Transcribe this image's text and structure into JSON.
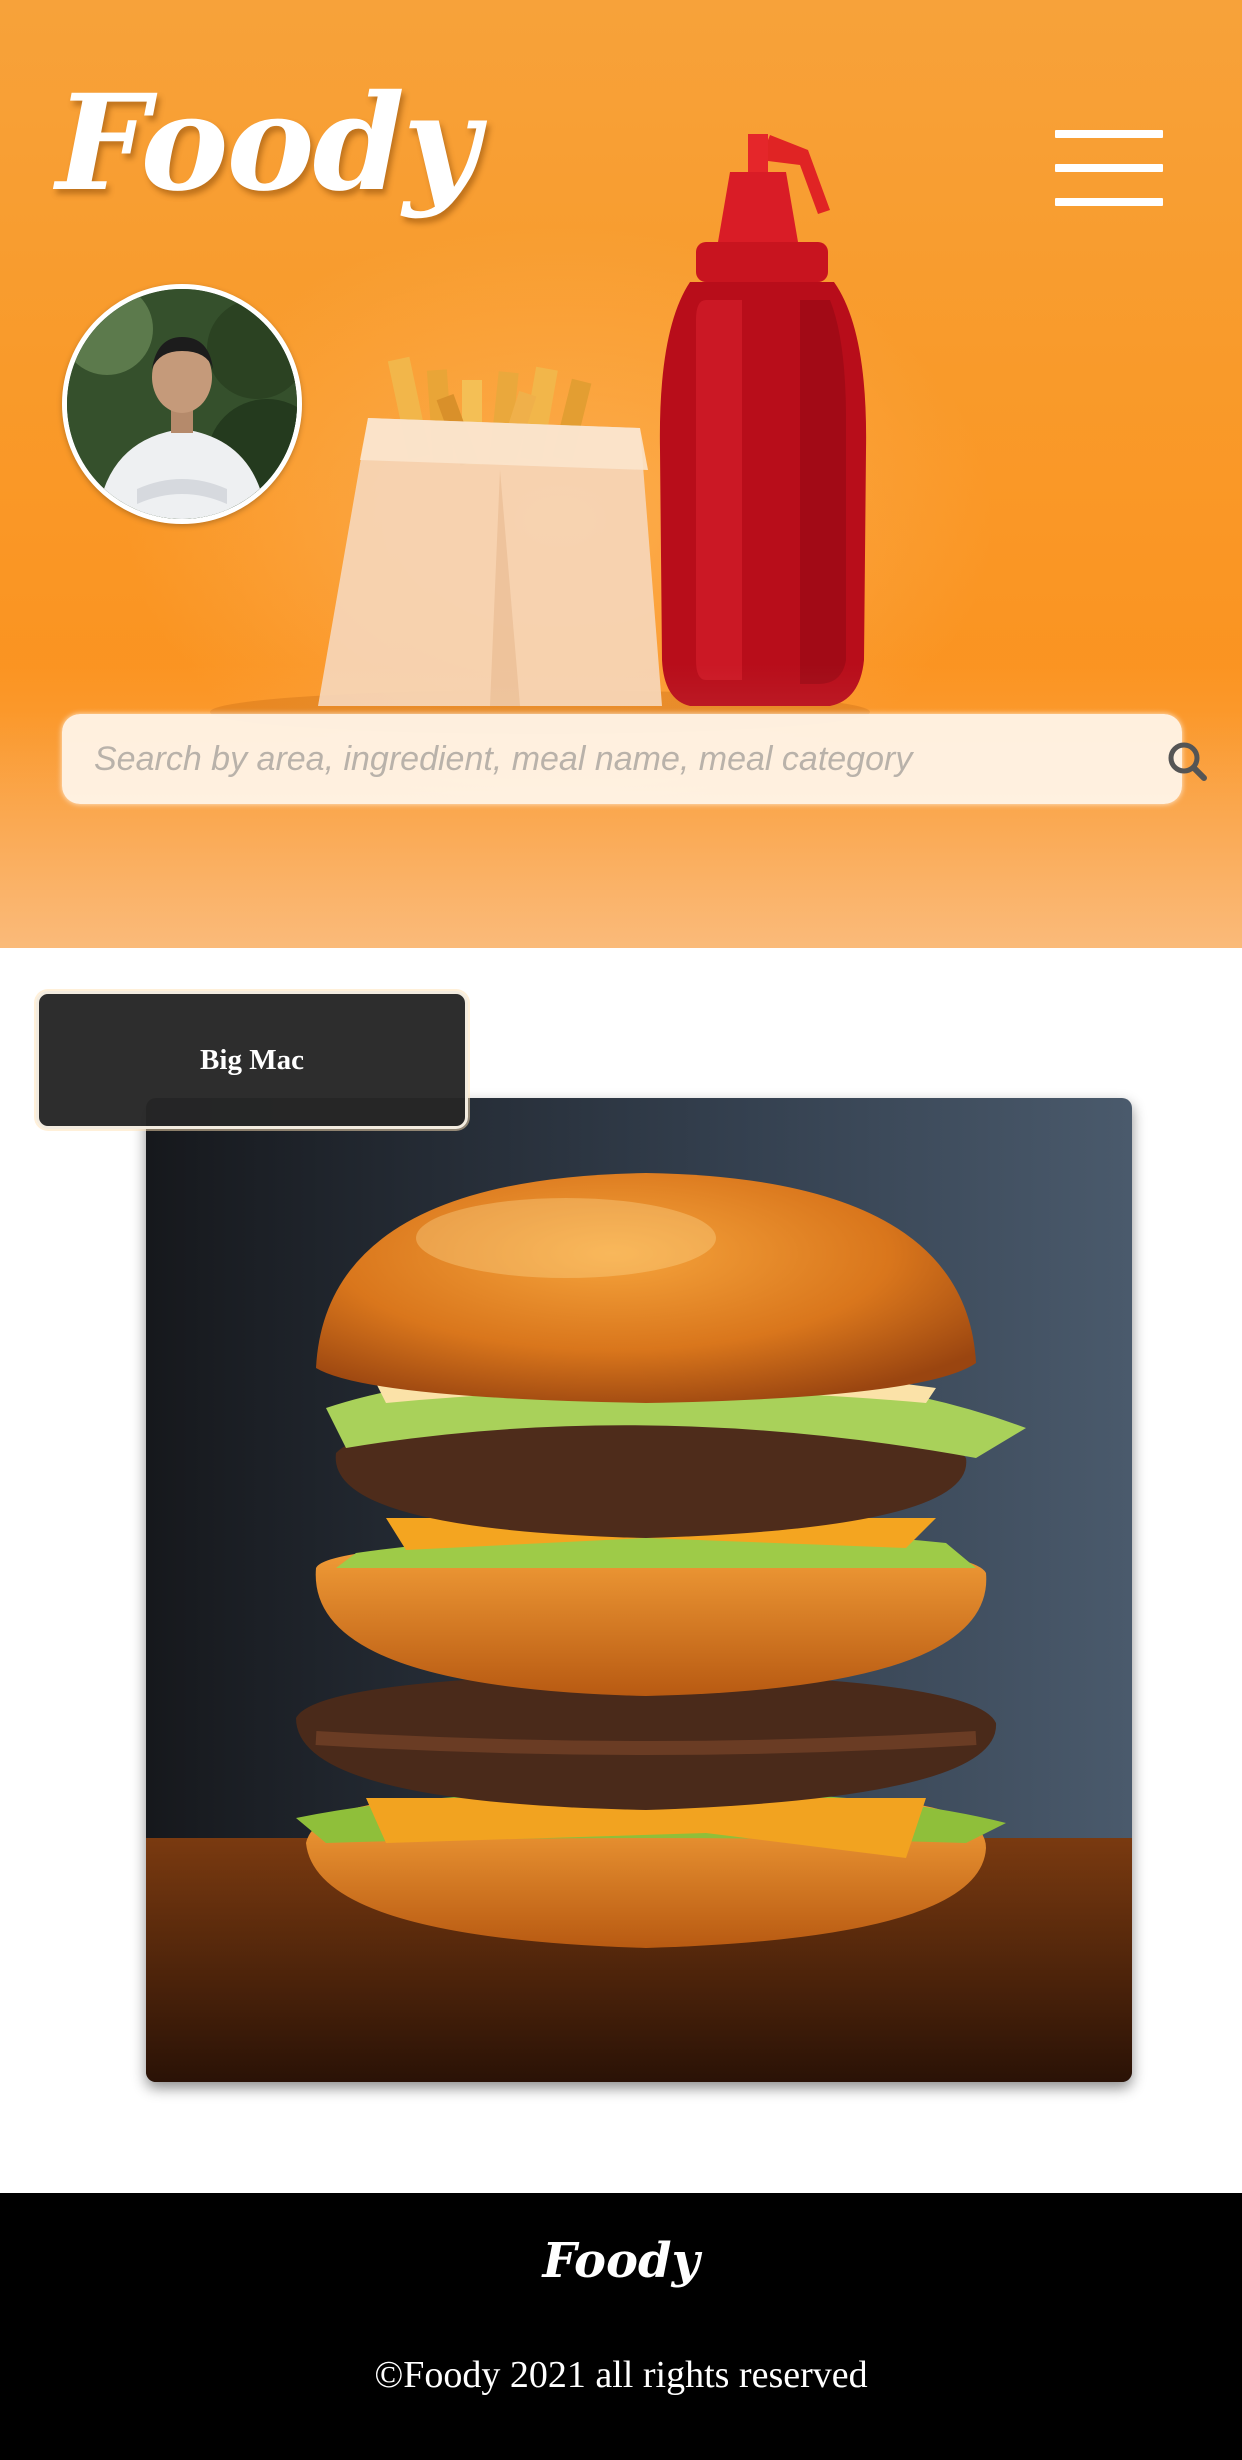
{
  "header": {
    "brand": "Foody",
    "menu_icon": "hamburger-menu-icon",
    "avatar_icon": "user-avatar"
  },
  "search": {
    "placeholder": "Search by area, ingredient, meal name, meal category",
    "icon": "search-icon"
  },
  "meal": {
    "title": "Big Mac",
    "image": "burger-photo"
  },
  "footer": {
    "brand": "Foody",
    "copyright": "©Foody 2021 all rights reserved"
  },
  "colors": {
    "hero_orange": "#fb9320",
    "card_dark": "#262626",
    "footer_bg": "#000000",
    "text_light": "#ffffff"
  }
}
